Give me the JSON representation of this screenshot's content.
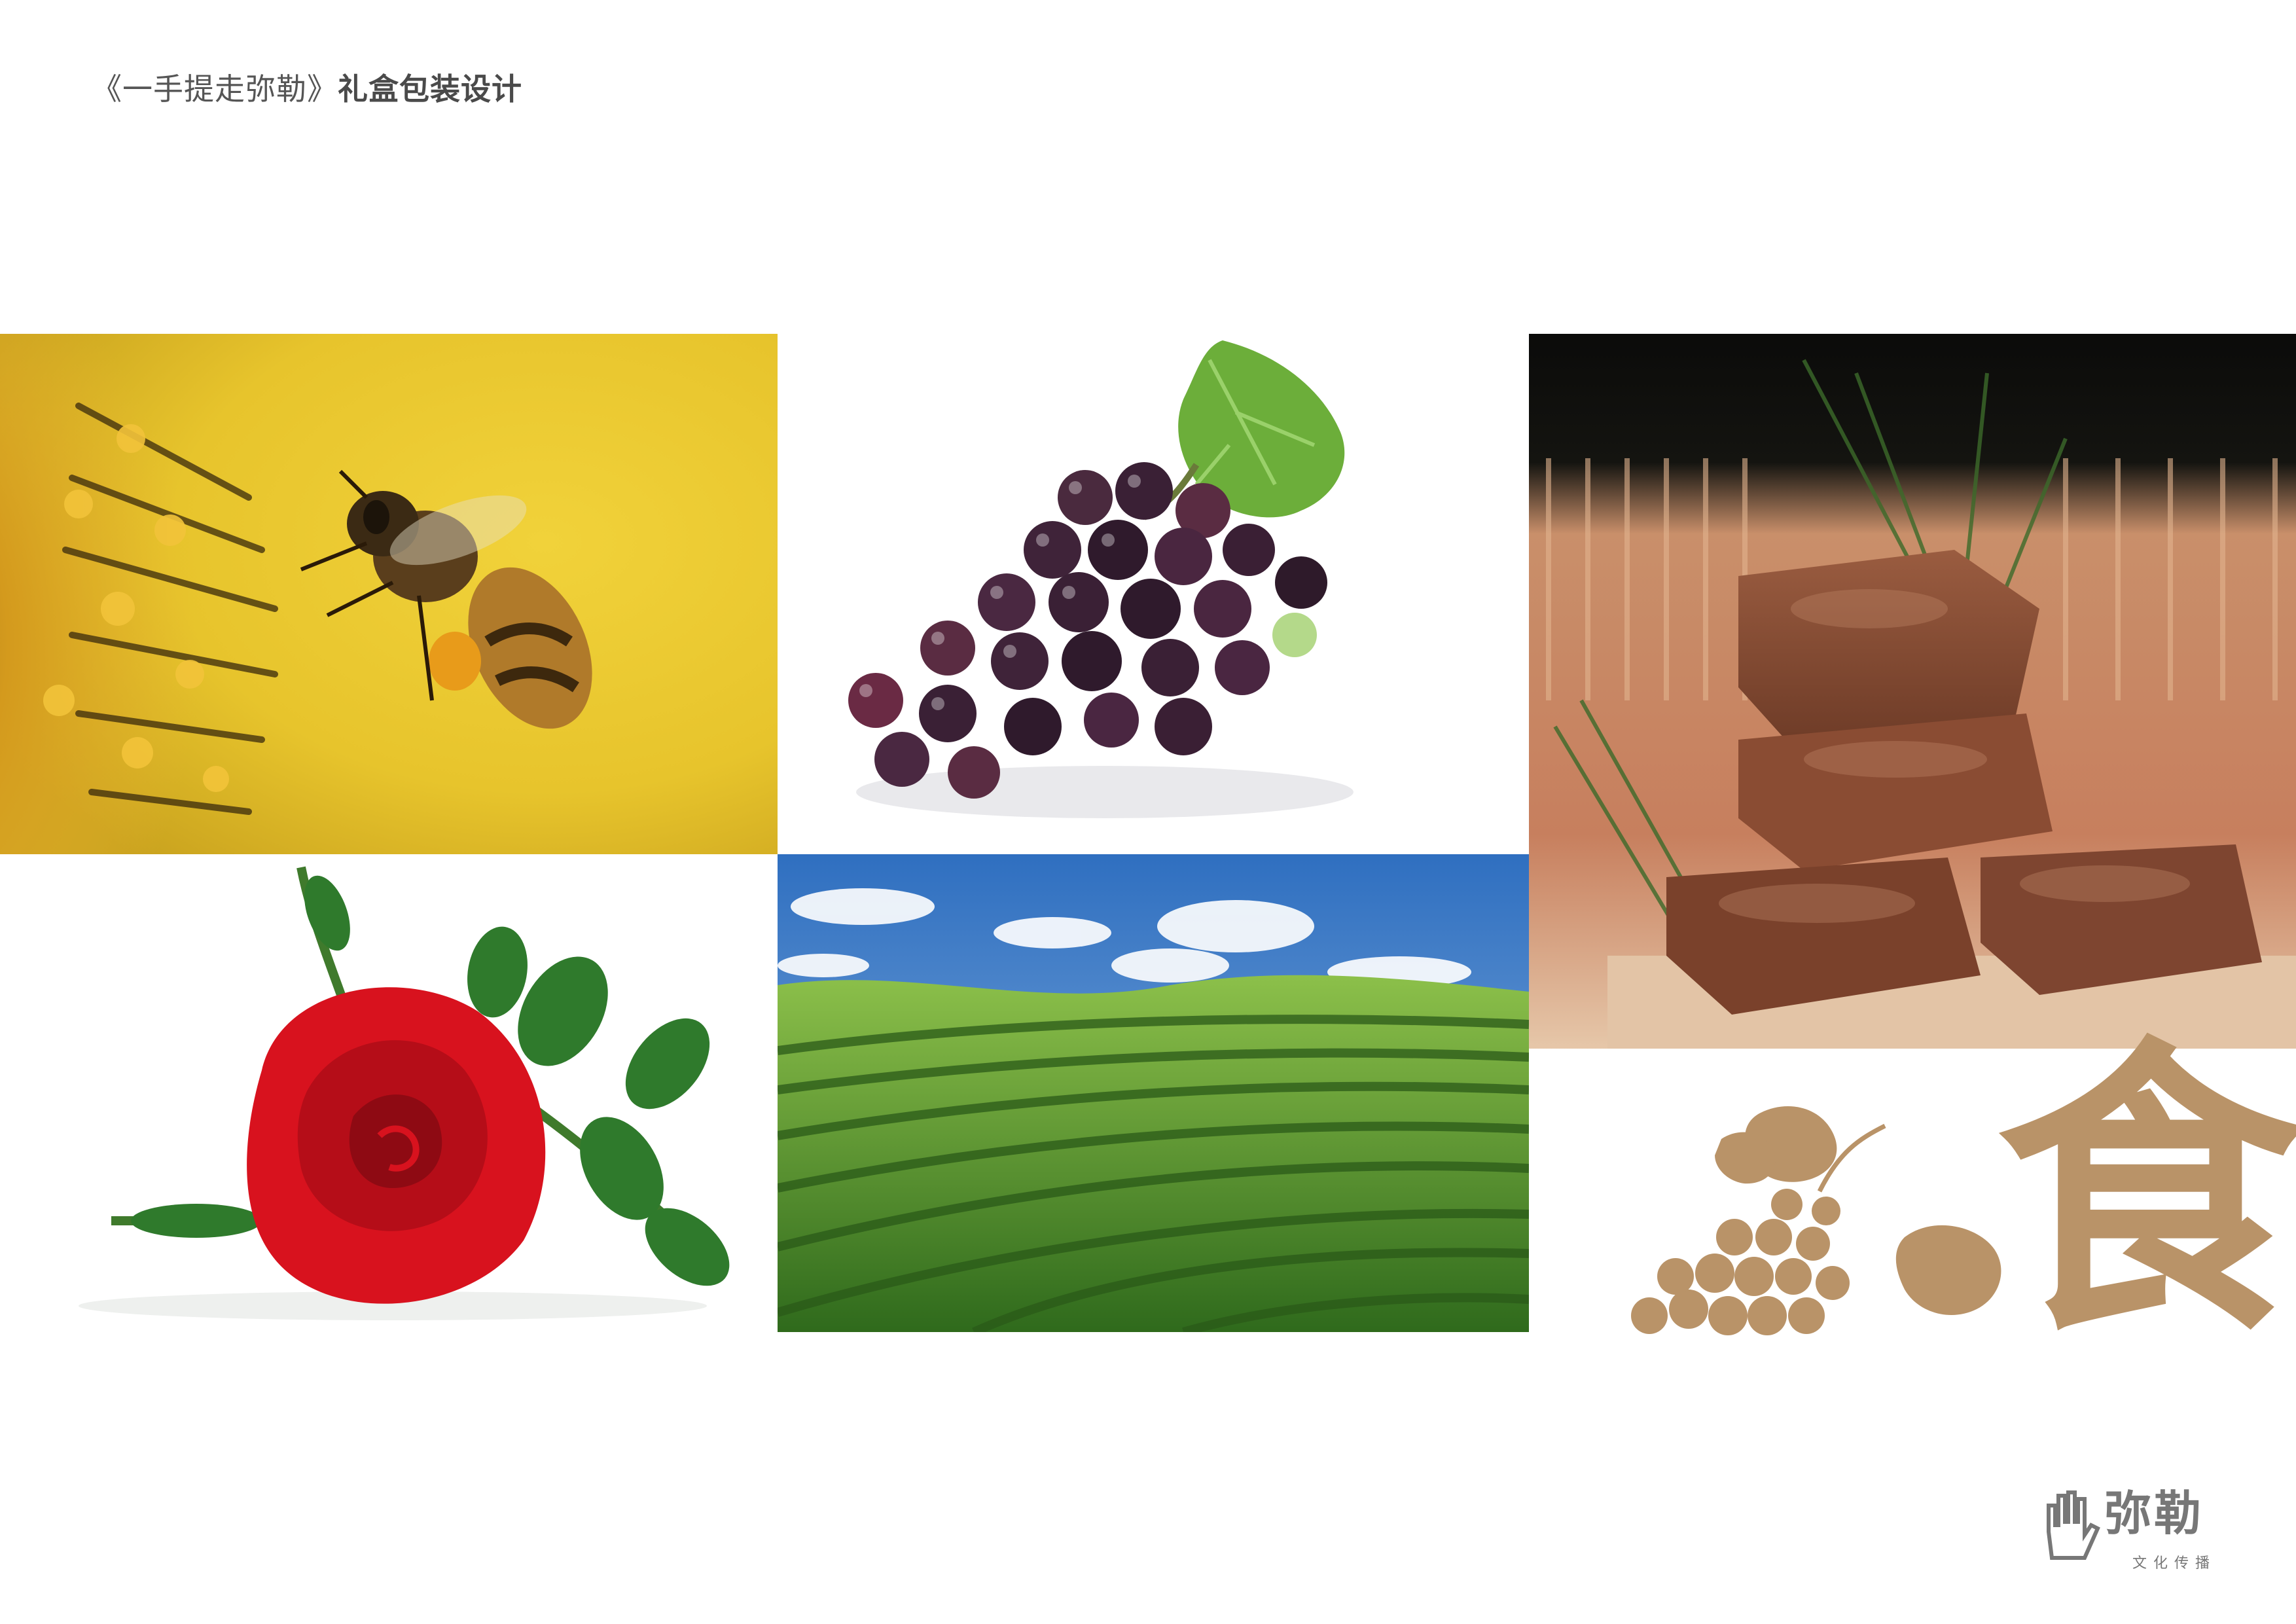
{
  "header": {
    "title_regular": "《一手提走弥勒》",
    "title_bold": "礼盒包装设计"
  },
  "feature": {
    "character": "食",
    "accent_color": "#b99368"
  },
  "logo": {
    "name": "弥勒",
    "subtitle": "文化传播",
    "icon": "hand-icon"
  },
  "panels": [
    {
      "name": "bee-sunflower-photo",
      "icon": "bee-photo"
    },
    {
      "name": "grapes-photo",
      "icon": "grapes-photo"
    },
    {
      "name": "brown-sugar-photo",
      "icon": "brown-sugar-photo"
    },
    {
      "name": "rose-photo",
      "icon": "rose-photo"
    },
    {
      "name": "tea-field-photo",
      "icon": "tea-field-photo"
    },
    {
      "name": "grape-emblem",
      "icon": "grape-icon"
    }
  ]
}
